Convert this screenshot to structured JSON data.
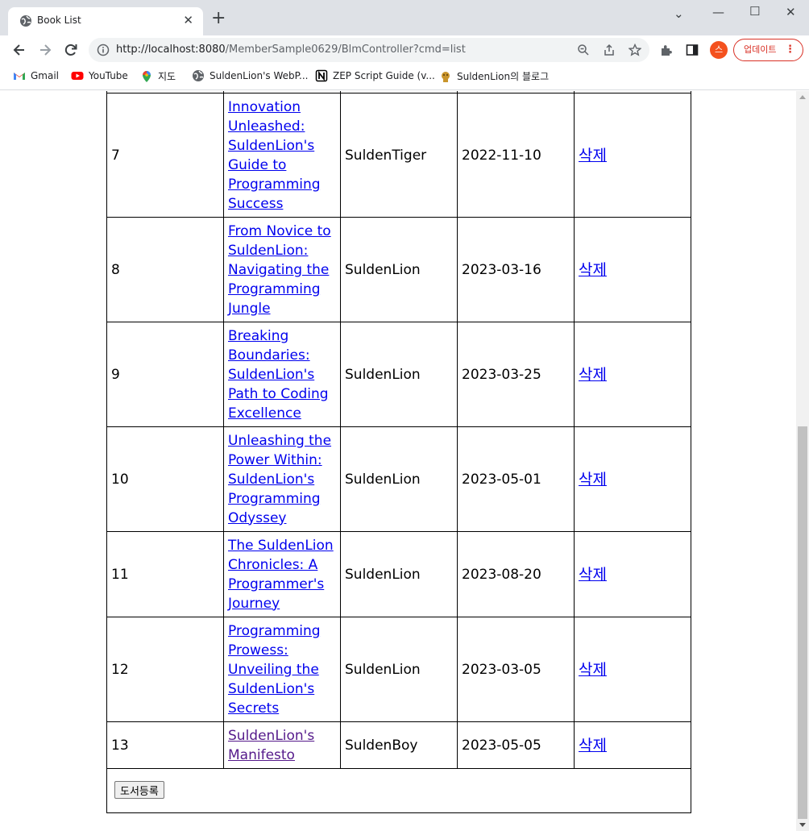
{
  "browser": {
    "tab_title": "Book List",
    "url_host": "http://localhost:8080",
    "url_path": "/MemberSample0629/BlmController?cmd=list",
    "profile_initial": "스",
    "update_label": "업데이트",
    "bookmarks": [
      {
        "label": "Gmail",
        "icon": "gmail-icon"
      },
      {
        "label": "YouTube",
        "icon": "youtube-icon"
      },
      {
        "label": "지도",
        "icon": "maps-icon"
      },
      {
        "label": "SuldenLion's WebP...",
        "icon": "globe-icon"
      },
      {
        "label": "ZEP Script Guide (v...",
        "icon": "notion-icon"
      },
      {
        "label": "SuldenLion의 블로그",
        "icon": "blog-icon"
      }
    ]
  },
  "books": {
    "rows": [
      {
        "no": "7",
        "title": "Innovation Unleashed: SuldenLion's Guide to Programming Success",
        "author": "SuldenTiger",
        "date": "2022-11-10",
        "delete_label": "삭제"
      },
      {
        "no": "8",
        "title": "From Novice to SuldenLion: Navigating the Programming Jungle",
        "author": "SuldenLion",
        "date": "2023-03-16",
        "delete_label": "삭제"
      },
      {
        "no": "9",
        "title": "Breaking Boundaries: SuldenLion's Path to Coding Excellence",
        "author": "SuldenLion",
        "date": "2023-03-25",
        "delete_label": "삭제"
      },
      {
        "no": "10",
        "title": "Unleashing the Power Within: SuldenLion's Programming Odyssey",
        "author": "SuldenLion",
        "date": "2023-05-01",
        "delete_label": "삭제"
      },
      {
        "no": "11",
        "title": "The SuldenLion Chronicles: A Programmer's Journey",
        "author": "SuldenLion",
        "date": "2023-08-20",
        "delete_label": "삭제"
      },
      {
        "no": "12",
        "title": "Programming Prowess: Unveiling the SuldenLion's Secrets",
        "author": "SuldenLion",
        "date": "2023-03-05",
        "delete_label": "삭제"
      },
      {
        "no": "13",
        "title": "SuldenLion's Manifesto",
        "author": "SuldenBoy",
        "date": "2023-05-05",
        "delete_label": "삭제"
      }
    ],
    "register_button": "도서등록"
  },
  "colors": {
    "link": "#0000ee",
    "visited_link": "#551a8b",
    "update_accent": "#d93025",
    "profile": "#f4511e"
  }
}
